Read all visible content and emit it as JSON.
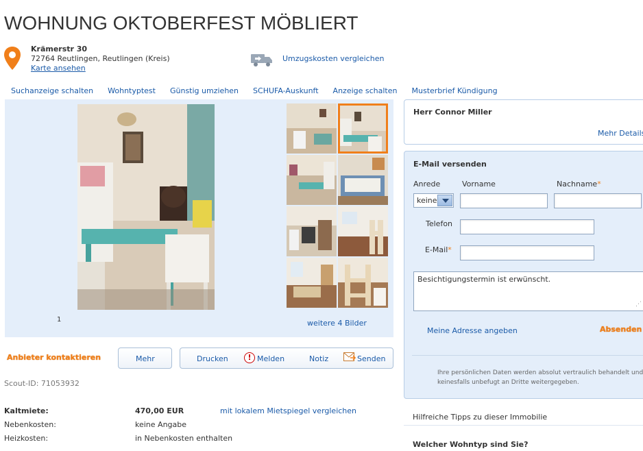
{
  "page": {
    "title": "WOHNUNG OKTOBERFEST MÖBLIERT"
  },
  "address": {
    "street": "Krämerstr 30",
    "city": "72764 Reutlingen, Reutlingen (Kreis)",
    "map_link": "Karte ansehen",
    "compare_moving": "Umzugskosten vergleichen"
  },
  "nav": {
    "items": [
      {
        "label": "Suchanzeige schalten"
      },
      {
        "label": "Wohntyptest"
      },
      {
        "label": "Günstig umziehen"
      },
      {
        "label": "SCHUFA-Auskunft"
      },
      {
        "label": "Anzeige schalten"
      },
      {
        "label": "Musterbrief Kündigung"
      }
    ]
  },
  "gallery": {
    "counter": "1",
    "more_images": "weitere 4 Bilder"
  },
  "actions": {
    "contact": "Anbieter kontaktieren",
    "more": "Mehr",
    "print": "Drucken",
    "report": "Melden",
    "note": "Notiz",
    "send": "Senden"
  },
  "scout_id": "Scout-ID: 71053932",
  "facts": [
    {
      "key": "Kaltmiete:",
      "value": "470,00 EUR",
      "extra": "mit lokalem Mietspiegel vergleichen",
      "bold": true
    },
    {
      "key": "Nebenkosten:",
      "value": "keine Angabe",
      "extra": "",
      "bold": false
    },
    {
      "key": "Heizkosten:",
      "value": "in Nebenkosten enthalten",
      "extra": "",
      "bold": false
    }
  ],
  "landlord": {
    "name": "Herr Connor Miller",
    "more_details": "Mehr Details"
  },
  "mail_form": {
    "heading": "E-Mail versenden",
    "salutation_label": "Anrede",
    "salutation_value": "keine",
    "firstname_label": "Vorname",
    "lastname_label": "Nachname",
    "phone_label": "Telefon",
    "email_label": "E-Mail",
    "required_mark": "*",
    "message": "Besichtigungstermin ist erwünscht.",
    "add_address": "Meine Adresse angeben",
    "submit": "Absenden",
    "privacy": "Ihre persönlichen Daten werden absolut vertraulich behandelt und keinesfalls unbefugt an Dritte weitergegeben."
  },
  "sidebar": {
    "tips": "Hilfreiche Tipps zu dieser Immobilie",
    "living_type": "Welcher Wohntyp sind Sie?"
  },
  "colors": {
    "accent": "#f07f1a",
    "link": "#1a5aa8",
    "panel_bg": "#e4eefa"
  }
}
